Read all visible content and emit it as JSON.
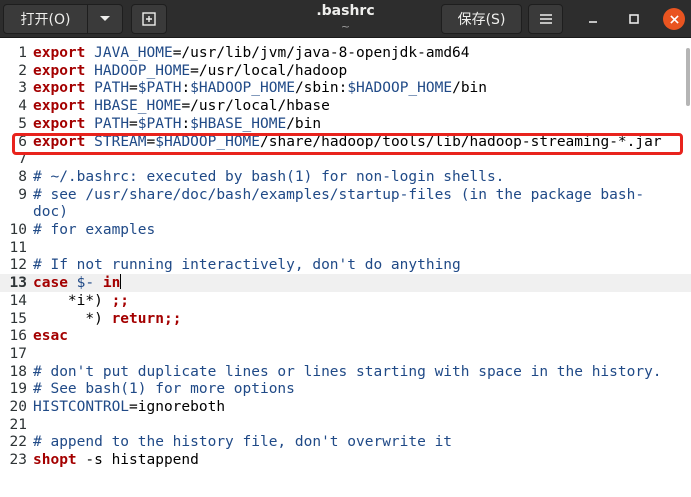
{
  "window": {
    "title": ".bashrc",
    "subtitle": "~",
    "open_label": "打开(O)",
    "save_label": "保存(S)"
  },
  "editor": {
    "current_line": 13,
    "lines": [
      {
        "n": "1",
        "parts": [
          [
            "kw",
            "export"
          ],
          [
            "t",
            " "
          ],
          [
            "var",
            "JAVA_HOME"
          ],
          [
            "t",
            "=/usr/lib/jvm/java-8-openjdk-amd64"
          ]
        ]
      },
      {
        "n": "2",
        "parts": [
          [
            "kw",
            "export"
          ],
          [
            "t",
            " "
          ],
          [
            "var",
            "HADOOP_HOME"
          ],
          [
            "t",
            "=/usr/local/hadoop"
          ]
        ]
      },
      {
        "n": "3",
        "parts": [
          [
            "kw",
            "export"
          ],
          [
            "t",
            " "
          ],
          [
            "var",
            "PATH"
          ],
          [
            "t",
            "="
          ],
          [
            "var",
            "$PATH"
          ],
          [
            "t",
            ":"
          ],
          [
            "var",
            "$HADOOP_HOME"
          ],
          [
            "t",
            "/sbin:"
          ],
          [
            "var",
            "$HADOOP_HOME"
          ],
          [
            "t",
            "/bin"
          ]
        ]
      },
      {
        "n": "4",
        "parts": [
          [
            "kw",
            "export"
          ],
          [
            "t",
            " "
          ],
          [
            "var",
            "HBASE_HOME"
          ],
          [
            "t",
            "=/usr/local/hbase"
          ]
        ]
      },
      {
        "n": "5",
        "parts": [
          [
            "kw",
            "export"
          ],
          [
            "t",
            " "
          ],
          [
            "var",
            "PATH"
          ],
          [
            "t",
            "="
          ],
          [
            "var",
            "$PATH"
          ],
          [
            "t",
            ":"
          ],
          [
            "var",
            "$HBASE_HOME"
          ],
          [
            "t",
            "/bin"
          ]
        ]
      },
      {
        "n": "6",
        "parts": [
          [
            "kw",
            "export"
          ],
          [
            "t",
            " "
          ],
          [
            "var",
            "STREAM"
          ],
          [
            "t",
            "="
          ],
          [
            "var",
            "$HADOOP_HOME"
          ],
          [
            "t",
            "/share/hadoop/tools/lib/hadoop-streaming-*.jar"
          ]
        ]
      },
      {
        "n": "7",
        "parts": []
      },
      {
        "n": "8",
        "parts": [
          [
            "cmt",
            "# ~/.bashrc: executed by bash(1) for non-login shells."
          ]
        ]
      },
      {
        "n": "9",
        "parts": [
          [
            "cmt",
            "# see /usr/share/doc/bash/examples/startup-files (in the package bash-"
          ]
        ]
      },
      {
        "n": "",
        "parts": [
          [
            "cmt",
            "doc)"
          ]
        ]
      },
      {
        "n": "10",
        "parts": [
          [
            "cmt",
            "# for examples"
          ]
        ]
      },
      {
        "n": "11",
        "parts": []
      },
      {
        "n": "12",
        "parts": [
          [
            "cmt",
            "# If not running interactively, don't do anything"
          ]
        ]
      },
      {
        "n": "13",
        "parts": [
          [
            "kw",
            "case"
          ],
          [
            "t",
            " "
          ],
          [
            "var",
            "$-"
          ],
          [
            "t",
            " "
          ],
          [
            "kw",
            "in"
          ]
        ]
      },
      {
        "n": "14",
        "parts": [
          [
            "t",
            "    *i*) "
          ],
          [
            "kw",
            ";;"
          ]
        ]
      },
      {
        "n": "15",
        "parts": [
          [
            "t",
            "      *) "
          ],
          [
            "kw",
            "return"
          ],
          [
            "kw",
            ";;"
          ]
        ]
      },
      {
        "n": "16",
        "parts": [
          [
            "kw",
            "esac"
          ]
        ]
      },
      {
        "n": "17",
        "parts": []
      },
      {
        "n": "18",
        "parts": [
          [
            "cmt",
            "# don't put duplicate lines or lines starting with space in the history."
          ]
        ]
      },
      {
        "n": "19",
        "parts": [
          [
            "cmt",
            "# See bash(1) for more options"
          ]
        ]
      },
      {
        "n": "20",
        "parts": [
          [
            "var",
            "HISTCONTROL"
          ],
          [
            "t",
            "=ignoreboth"
          ]
        ]
      },
      {
        "n": "21",
        "parts": []
      },
      {
        "n": "22",
        "parts": [
          [
            "cmt",
            "# append to the history file, don't overwrite it"
          ]
        ]
      },
      {
        "n": "23",
        "parts": [
          [
            "kw",
            "shopt"
          ],
          [
            "t",
            " -s histappend"
          ]
        ]
      }
    ]
  },
  "icons": {
    "dropdown": "chevron-down-icon",
    "new_tab": "new-document-icon",
    "menu": "hamburger-menu-icon",
    "minimize": "minimize-icon",
    "maximize": "maximize-icon",
    "close": "close-icon"
  },
  "colors": {
    "keyword": "#a40000",
    "variable": "#204a87",
    "comment": "#204a87",
    "highlight_box": "#e8231d",
    "close_button": "#e95420"
  }
}
